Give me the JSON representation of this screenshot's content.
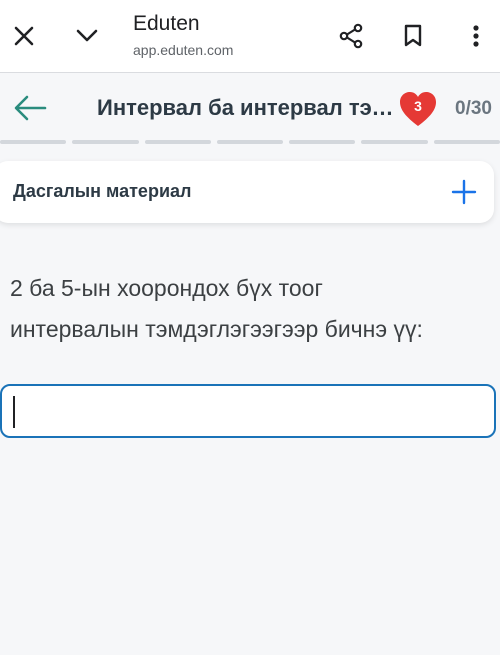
{
  "browser": {
    "title": "Eduten",
    "url": "app.eduten.com"
  },
  "lesson": {
    "title": "Интервал ба интервал тэмдэглэгээ",
    "lives": "3",
    "progress": "0/30",
    "segments": 7
  },
  "material": {
    "label": "Дасгалын материал"
  },
  "exercise": {
    "question_line1": "2 ба 5-ын хоорондох бүх тоог",
    "question_line2": "интервалын тэмдэглэгээгээр бичнэ үү:",
    "answer_value": ""
  },
  "colors": {
    "accent": "#1a73b8",
    "back_arrow": "#2a8c7e",
    "heart": "#e53935"
  }
}
